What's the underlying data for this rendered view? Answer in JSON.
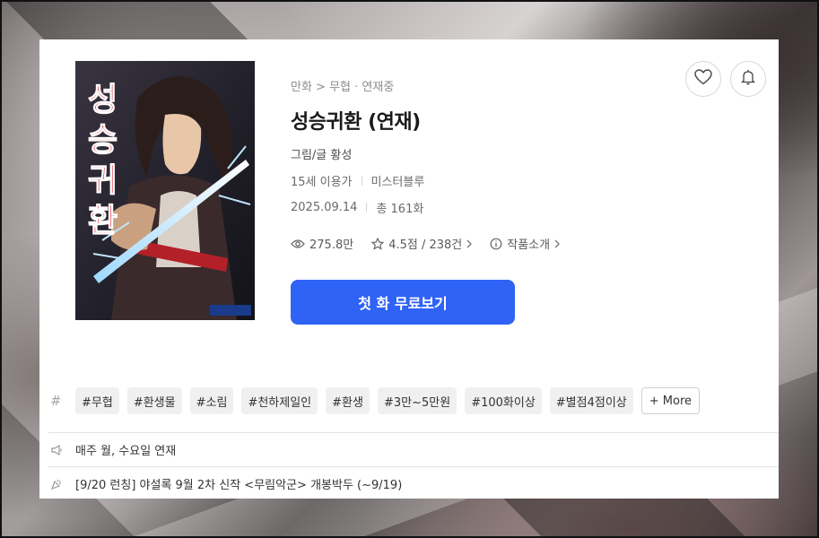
{
  "work": {
    "breadcrumb": "만화 > 무협 · 연재중",
    "title": "성승귀환 (연재)",
    "author": "그림/글 황성",
    "age_rating": "15세 이용가",
    "publisher": "미스터블루",
    "date": "2025.09.14",
    "episodes": "총 161화",
    "views": "275.8만",
    "rating": "4.5점 / 238건",
    "intro_label": "작품소개"
  },
  "cover": {
    "title_art": "성승귀환",
    "alt": "성승귀환"
  },
  "actions": {
    "first_episode_button": "첫 화 무료보기"
  },
  "tags": {
    "items": [
      "#무협",
      "#환생물",
      "#소림",
      "#천하제일인",
      "#환생",
      "#3만~5만원",
      "#100화이상",
      "#별점4점이상"
    ],
    "more_label": "+ More"
  },
  "notices": {
    "schedule": "매주 월, 수요일 연재",
    "event": "[9/20 런칭] 야설록 9월 2차 신작 <무림악군> 개봉박두 (~9/19)"
  },
  "colors": {
    "accent": "#2f63f5"
  }
}
